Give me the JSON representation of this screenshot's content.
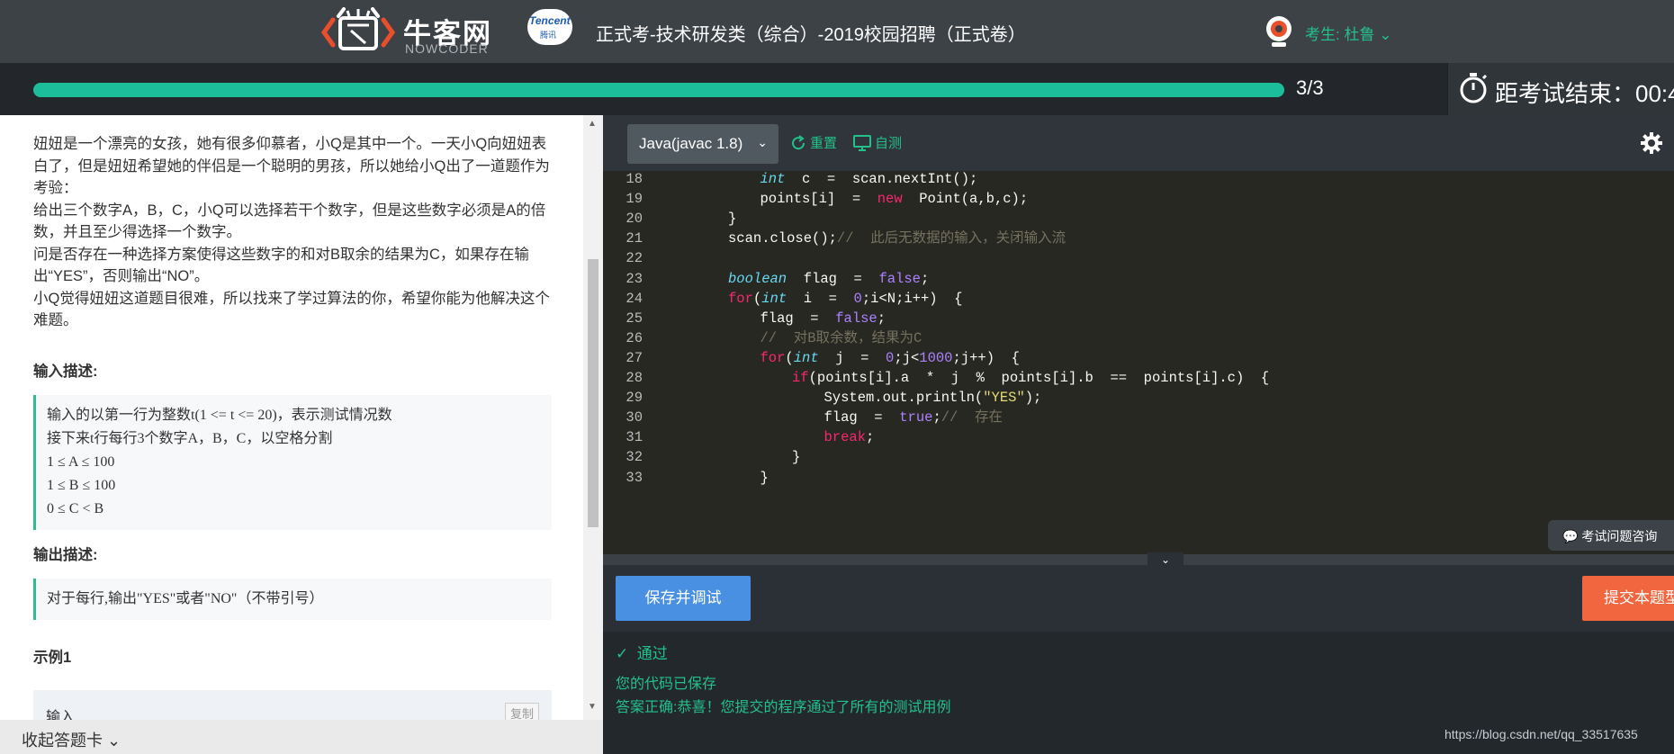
{
  "header": {
    "logo_cn": "牛客网",
    "logo_en": "NOWCODER",
    "partner_en": "Tencent",
    "partner_cn": "腾讯",
    "exam_title": "正式考-技术研发类（综合）-2019校园招聘（正式卷）",
    "candidate_label": "考生: ",
    "candidate_name": "杜鲁",
    "colors": {
      "brand": "#e94f2b",
      "accent": "#23c08a",
      "bar": "#3d4247"
    }
  },
  "progress": {
    "text": "3/3",
    "fraction": 1.0,
    "timer_label": "距考试结束：",
    "timer_value": "00:4"
  },
  "question": {
    "paragraphs": [
      "妞妞是一个漂亮的女孩，她有很多仰慕者，小Q是其中一个。一天小Q向妞妞表白了，但是妞妞希望她的伴侣是一个聪明的男孩，所以她给小Q出了一道题作为考验：",
      "给出三个数字A，B，C，小Q可以选择若干个数字，但是这些数字必须是A的倍数，并且至少得选择一个数字。",
      "问是否存在一种选择方案使得这些数字的和对B取余的结果为C，如果存在输出“YES”，否则输出“NO”。",
      "小Q觉得妞妞这道题目很难，所以找来了学过算法的你，希望你能为他解决这个难题。"
    ],
    "input_title": "输入描述:",
    "input_lines": [
      "输入的以第一行为整数t(1 <= t <= 20)，表示测试情况数",
      "接下来t行每行3个数字A，B，C，以空格分割",
      "1 ≤ A ≤ 100",
      "1 ≤ B ≤ 100",
      "0 ≤ C < B"
    ],
    "output_title": "输出描述:",
    "output_line": "对于每行,输出\"YES\"或者\"NO\"（不带引号）",
    "example_title": "示例1",
    "example_input_label": "输入",
    "copy_label": "复制",
    "collapse_label": "收起答题卡"
  },
  "editor": {
    "language": "Java(javac 1.8)",
    "reset_label": "重置",
    "selftest_label": "自测",
    "lines": [
      {
        "n": "18",
        "indent": 3
      },
      {
        "n": "19",
        "indent": 3
      },
      {
        "n": "20",
        "indent": 2
      },
      {
        "n": "21",
        "indent": 2
      },
      {
        "n": "22",
        "indent": 0
      },
      {
        "n": "23",
        "indent": 2
      },
      {
        "n": "24",
        "indent": 2
      },
      {
        "n": "25",
        "indent": 3
      },
      {
        "n": "26",
        "indent": 3
      },
      {
        "n": "27",
        "indent": 3
      },
      {
        "n": "28",
        "indent": 4
      },
      {
        "n": "29",
        "indent": 5
      },
      {
        "n": "30",
        "indent": 5
      },
      {
        "n": "31",
        "indent": 5
      },
      {
        "n": "32",
        "indent": 4
      },
      {
        "n": "33",
        "indent": 3
      }
    ],
    "code_text": [
      [
        [
          "ty",
          "int"
        ],
        [
          "",
          "  c  =  scan.nextInt();"
        ]
      ],
      [
        [
          "",
          "points[i]  =  "
        ],
        [
          "kw",
          "new"
        ],
        [
          "",
          "  Point(a,b,c);"
        ]
      ],
      [
        [
          "",
          "}"
        ]
      ],
      [
        [
          "",
          "scan.close();"
        ],
        [
          "cm",
          "//  此后无数据的输入，关闭输入流"
        ]
      ],
      [],
      [
        [
          "ty",
          "boolean"
        ],
        [
          "",
          "  flag  =  "
        ],
        [
          "nb",
          "false"
        ],
        [
          "",
          ";"
        ]
      ],
      [
        [
          "kw",
          "for"
        ],
        [
          "",
          "("
        ],
        [
          "ty",
          "int"
        ],
        [
          "",
          "  i  =  "
        ],
        [
          "nb",
          "0"
        ],
        [
          "",
          ";i<N;i++)  {"
        ]
      ],
      [
        [
          "",
          "flag  =  "
        ],
        [
          "nb",
          "false"
        ],
        [
          "",
          ";"
        ]
      ],
      [
        [
          "cm",
          "//  对B取余数，结果为C"
        ]
      ],
      [
        [
          "kw",
          "for"
        ],
        [
          "",
          "("
        ],
        [
          "ty",
          "int"
        ],
        [
          "",
          "  j  =  "
        ],
        [
          "nb",
          "0"
        ],
        [
          "",
          ";j<"
        ],
        [
          "nb",
          "1000"
        ],
        [
          "",
          ";j++)  {"
        ]
      ],
      [
        [
          "kw",
          "if"
        ],
        [
          "",
          "(points[i].a  *  j  %  points[i].b  ==  points[i].c)  {"
        ]
      ],
      [
        [
          "",
          "System.out.println("
        ],
        [
          "st",
          "\"YES\""
        ],
        [
          "",
          ");"
        ]
      ],
      [
        [
          "",
          "flag  =  "
        ],
        [
          "nb",
          "true"
        ],
        [
          "",
          ";"
        ],
        [
          "cm",
          "//  存在"
        ]
      ],
      [
        [
          "kw",
          "break"
        ],
        [
          "",
          ";"
        ]
      ],
      [
        [
          "",
          "}"
        ]
      ],
      [
        [
          "",
          "}"
        ]
      ]
    ],
    "consult_label": "考试问题咨询"
  },
  "actions": {
    "save_label": "保存并调试",
    "submit_label": "提交本题型"
  },
  "result": {
    "status": "通过",
    "saved_msg": "您的代码已保存",
    "correct_msg": "答案正确:恭喜！您提交的程序通过了所有的测试用例"
  },
  "watermark": "https://blog.csdn.net/qq_33517635"
}
